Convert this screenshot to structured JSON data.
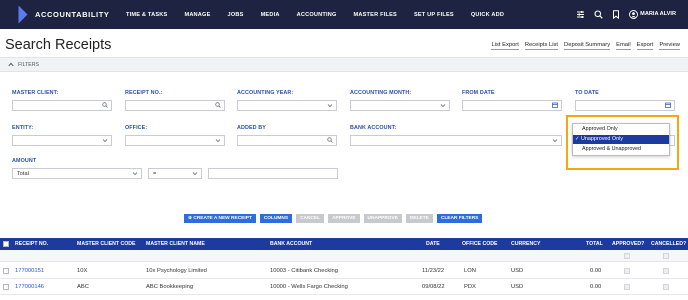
{
  "nav": {
    "logo": "ACCOUNTABILITY",
    "items": [
      "TIME & TASKS",
      "MANAGE",
      "JOBS",
      "MEDIA",
      "ACCOUNTING",
      "MASTER FILES",
      "SET UP FILES",
      "QUICK ADD"
    ],
    "user_name": "MARIA ALVIR",
    "icons": [
      "sliders-icon",
      "search-icon",
      "bookmark-icon",
      "user-icon"
    ]
  },
  "page": {
    "title": "Search Receipts",
    "actions": [
      "List Export",
      "Receipts List",
      "Deposit Summary",
      "Email",
      "Export",
      "Preview"
    ]
  },
  "filters": {
    "toggle_label": "FILTERS",
    "labels": {
      "master_client": "MASTER CLIENT:",
      "receipt_no": "RECEIPT NO.:",
      "accounting_year": "ACCOUNTING YEAR:",
      "accounting_month": "ACCOUNTING MONTH:",
      "from_date": "FROM DATE",
      "to_date": "TO DATE",
      "entity": "ENTITY:",
      "office": "OFFICE:",
      "added_by": "ADDED BY",
      "bank_account": "BANK ACCOUNT:",
      "amount": "AMOUNT"
    },
    "amount_type": "Total",
    "amount_operator": "="
  },
  "approval_dropdown": {
    "options": [
      "Approved Only",
      "Unapproved Only",
      "Approved & Unapproved"
    ],
    "selected_index": 1,
    "check_mark": "✓"
  },
  "buttons": {
    "create": "CREATE A NEW RECEIPT",
    "columns": "COLUMNS",
    "cancel": "CANCEL",
    "approve": "APPROVE",
    "unapprove": "UNAPPROVE",
    "delete": "DELETE",
    "clear_filters": "CLEAR FILTERS"
  },
  "table": {
    "headers": [
      "RECEIPT NO.",
      "MASTER CLIENT CODE",
      "MASTER CLIENT NAME",
      "BANK ACCOUNT",
      "DATE",
      "OFFICE CODE",
      "CURRENCY",
      "TOTAL",
      "APPROVED?",
      "CANCELLED?"
    ],
    "rows": [
      {
        "receipt_no": "177000151",
        "client_code": "10X",
        "client_name": "10x Psychology Limited",
        "bank_account": "10003 - Citibank Checking",
        "date": "11/23/22",
        "office_code": "LON",
        "currency": "USD",
        "total": "0.00"
      },
      {
        "receipt_no": "177000146",
        "client_code": "ABC",
        "client_name": "ABC Bookkeeping",
        "bank_account": "10000 - Wells Fargo Checking",
        "date": "09/08/22",
        "office_code": "PDX",
        "currency": "USD",
        "total": "0.00"
      }
    ]
  },
  "colors": {
    "nav_bg": "#1d2340",
    "accent": "#1d3a9e",
    "button_blue": "#2d6de0",
    "label_blue": "#2b4fa8",
    "highlight": "#f3a712"
  }
}
